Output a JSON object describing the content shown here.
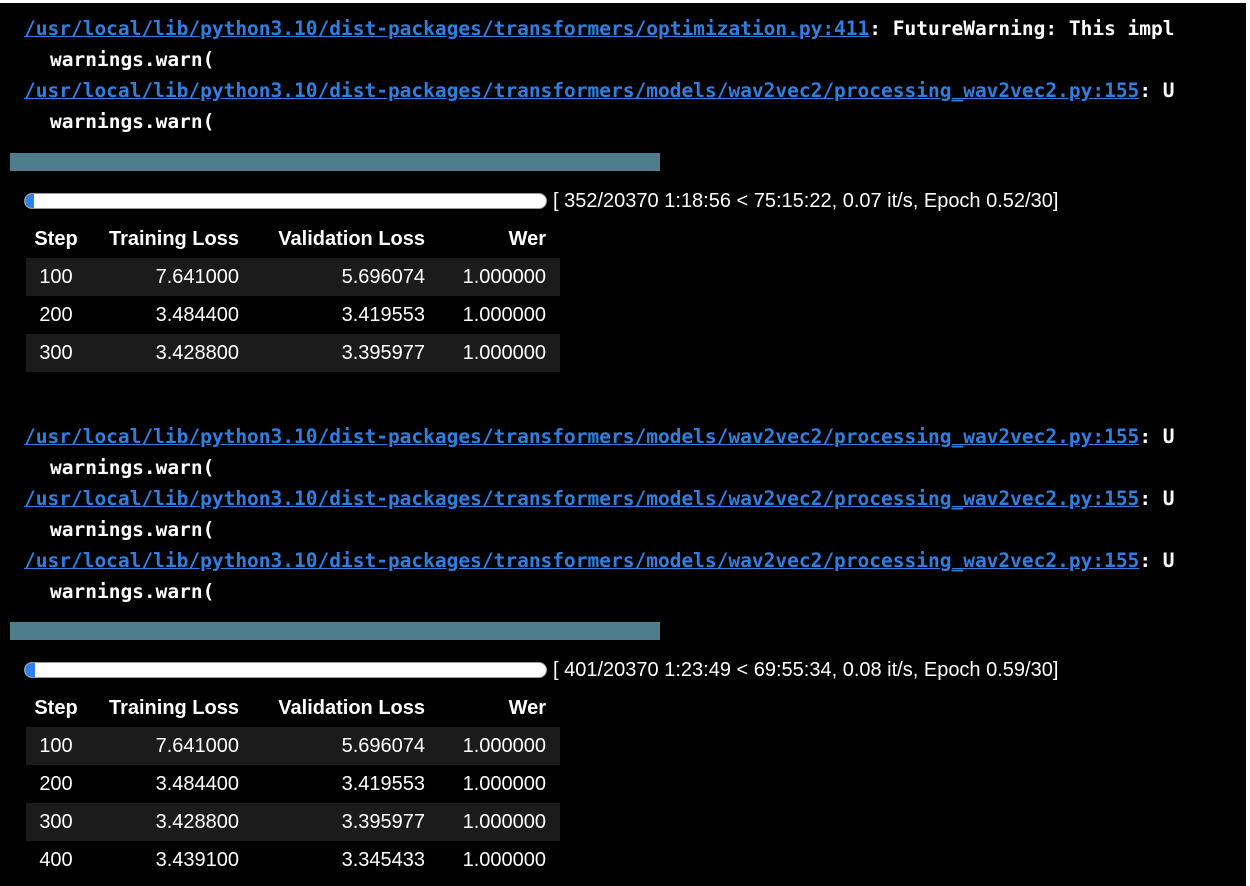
{
  "colors": {
    "background": "#000000",
    "link": "#2f7fe0",
    "phase_bar": "#4e7d8e",
    "progress_fill": "#2f80ed",
    "row_stripe": "#1b1b1b"
  },
  "log_top": {
    "warn1_link": "/usr/local/lib/python3.10/dist-packages/transformers/optimization.py:411",
    "warn1_rest": ": FutureWarning: This impl",
    "warn_call": "warnings.warn(",
    "warn2_link": "/usr/local/lib/python3.10/dist-packages/transformers/models/wav2vec2/processing_wav2vec2.py:155",
    "warn2_rest": ": U"
  },
  "run1": {
    "progress_fraction": 0.0173,
    "progress_text": "[ 352/20370 1:18:56 < 75:15:22, 0.07 it/s, Epoch 0.52/30]",
    "headers": [
      "Step",
      "Training Loss",
      "Validation Loss",
      "Wer"
    ],
    "rows": [
      [
        "100",
        "7.641000",
        "5.696074",
        "1.000000"
      ],
      [
        "200",
        "3.484400",
        "3.419553",
        "1.000000"
      ],
      [
        "300",
        "3.428800",
        "3.395977",
        "1.000000"
      ]
    ]
  },
  "log_mid": {
    "link": "/usr/local/lib/python3.10/dist-packages/transformers/models/wav2vec2/processing_wav2vec2.py:155",
    "rest": ": U",
    "warn_call": "warnings.warn("
  },
  "run2": {
    "progress_fraction": 0.0197,
    "progress_text": "[ 401/20370 1:23:49 < 69:55:34, 0.08 it/s, Epoch 0.59/30]",
    "headers": [
      "Step",
      "Training Loss",
      "Validation Loss",
      "Wer"
    ],
    "rows": [
      [
        "100",
        "7.641000",
        "5.696074",
        "1.000000"
      ],
      [
        "200",
        "3.484400",
        "3.419553",
        "1.000000"
      ],
      [
        "300",
        "3.428800",
        "3.395977",
        "1.000000"
      ],
      [
        "400",
        "3.439100",
        "3.345433",
        "1.000000"
      ]
    ]
  }
}
